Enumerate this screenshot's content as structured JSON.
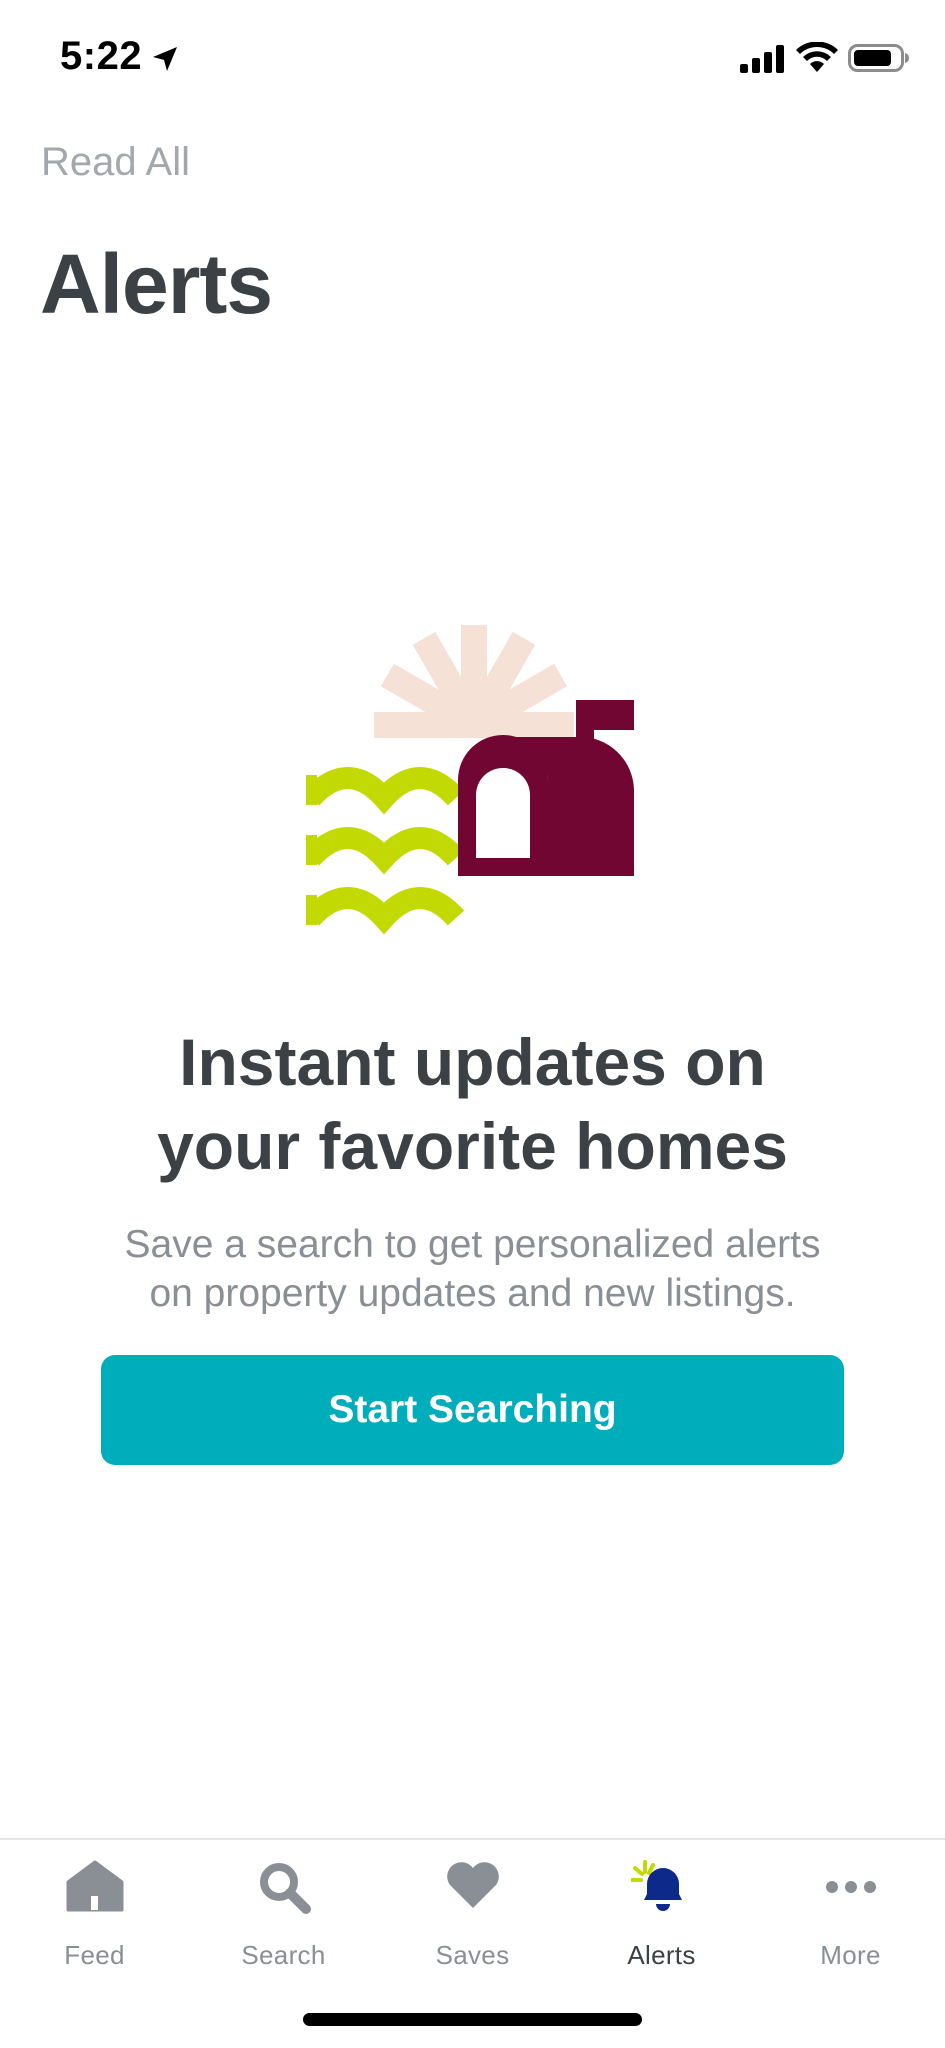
{
  "status_bar": {
    "time": "5:22"
  },
  "header": {
    "read_all": "Read All",
    "title": "Alerts"
  },
  "empty_state": {
    "headline_line1": "Instant updates on",
    "headline_line2": "your favorite homes",
    "subtext_line1": "Save a search to get personalized alerts",
    "subtext_line2": "on property updates and new listings.",
    "cta_label": "Start Searching",
    "illustration": "mailbox-with-sun-and-waves"
  },
  "tabs": [
    {
      "label": "Feed",
      "icon": "home-icon",
      "active": false
    },
    {
      "label": "Search",
      "icon": "search-icon",
      "active": false
    },
    {
      "label": "Saves",
      "icon": "heart-icon",
      "active": false
    },
    {
      "label": "Alerts",
      "icon": "bell-icon",
      "active": true
    },
    {
      "label": "More",
      "icon": "more-icon",
      "active": false
    }
  ],
  "colors": {
    "accent": "#00adbb",
    "text_dark": "#3b4144",
    "text_muted": "#8a8f95",
    "mailbox": "#720632",
    "waves": "#c3d903",
    "sun": "#f5e1d6",
    "active_tab_icon": "#0d2a8a"
  }
}
